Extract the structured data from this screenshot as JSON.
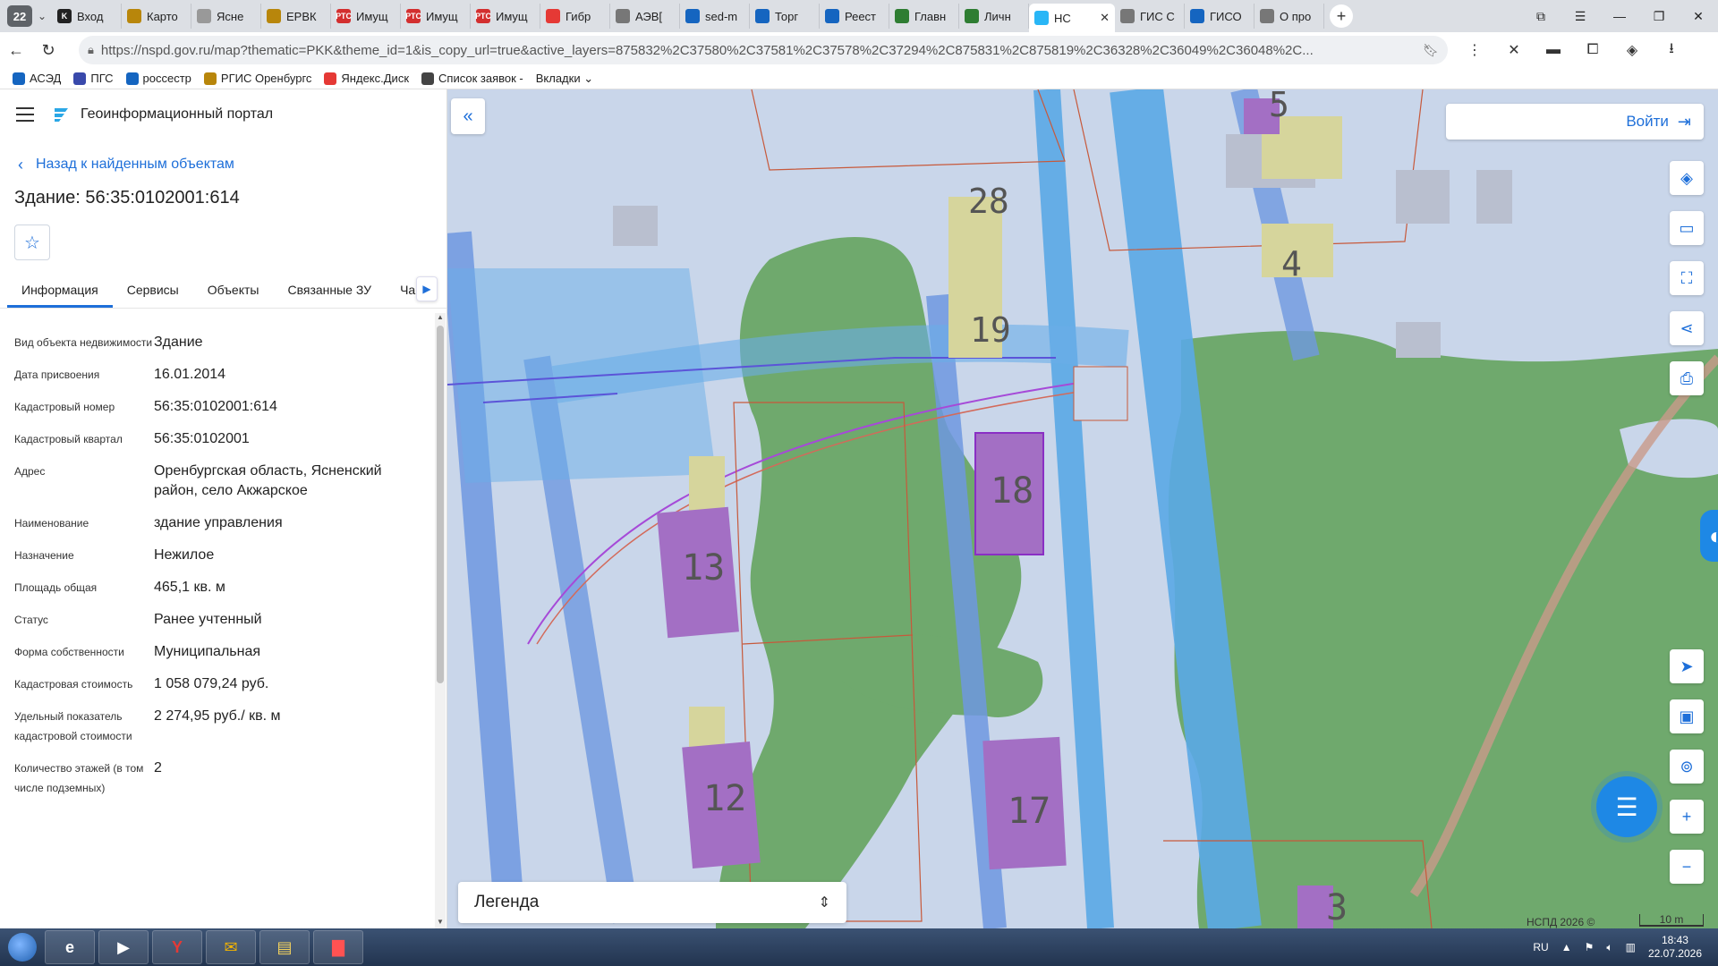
{
  "browser": {
    "tab_count": "22",
    "tabs": [
      {
        "label": "Вход",
        "color": "#222222",
        "glyph": "K"
      },
      {
        "label": "Карто",
        "color": "#b8860b",
        "glyph": ""
      },
      {
        "label": "Ясне",
        "color": "#999999",
        "glyph": ""
      },
      {
        "label": "ЕРВК",
        "color": "#b8860b",
        "glyph": ""
      },
      {
        "label": "Имущ",
        "color": "#d32f2f",
        "glyph": "РТС"
      },
      {
        "label": "Имущ",
        "color": "#d32f2f",
        "glyph": "РТС"
      },
      {
        "label": "Имущ",
        "color": "#d32f2f",
        "glyph": "РТС"
      },
      {
        "label": "Гибр",
        "color": "#e53935",
        "glyph": ""
      },
      {
        "label": "АЭВ[",
        "color": "#777777",
        "glyph": ""
      },
      {
        "label": "sed-m",
        "color": "#1565c0",
        "glyph": ""
      },
      {
        "label": "Торг",
        "color": "#1565c0",
        "glyph": ""
      },
      {
        "label": "Реест",
        "color": "#1565c0",
        "glyph": ""
      },
      {
        "label": "Главн",
        "color": "#2e7d32",
        "glyph": ""
      },
      {
        "label": "Личн",
        "color": "#2e7d32",
        "glyph": ""
      },
      {
        "label": "НС",
        "color": "#29b6f6",
        "glyph": "",
        "active": true
      },
      {
        "label": "ГИС С",
        "color": "#777777",
        "glyph": ""
      },
      {
        "label": "ГИСО",
        "color": "#1565c0",
        "glyph": ""
      },
      {
        "label": "О про",
        "color": "#777777",
        "glyph": ""
      }
    ],
    "tab_close": "✕",
    "new_tab": "+",
    "url": "https://nspd.gov.ru/map?thematic=PKK&theme_id=1&is_copy_url=true&active_layers=875832%2C37580%2C37581%2C37578%2C37294%2C875831%2C875819%2C36328%2C36049%2C36048%2C...",
    "bookmarks": [
      {
        "label": "АСЭД",
        "color": "#1565c0"
      },
      {
        "label": "ПГС",
        "color": "#3949ab"
      },
      {
        "label": "россестр",
        "color": "#1565c0"
      },
      {
        "label": "РГИС Оренбургс",
        "color": "#b8860b"
      },
      {
        "label": "Яндекс.Диск",
        "color": "#e53935"
      },
      {
        "label": "Список заявок -",
        "color": "#444444"
      },
      {
        "label": "Вкладки ⌄",
        "color": ""
      }
    ]
  },
  "panel": {
    "portal_title": "Геоинформационный портал",
    "back_link": "Назад к найденным объектам",
    "object_title": "Здание: 56:35:0102001:614",
    "tabs": [
      "Информация",
      "Сервисы",
      "Объекты",
      "Связанные ЗУ",
      "Ча"
    ],
    "fields": [
      {
        "label": "Вид объекта недвижимости",
        "value": "Здание"
      },
      {
        "label": "Дата присвоения",
        "value": "16.01.2014"
      },
      {
        "label": "Кадастровый номер",
        "value": "56:35:0102001:614"
      },
      {
        "label": "Кадастровый квартал",
        "value": "56:35:0102001"
      },
      {
        "label": "Адрес",
        "value": "Оренбургская область, Ясненский район, село Акжарское"
      },
      {
        "label": "Наименование",
        "value": "здание управления"
      },
      {
        "label": "Назначение",
        "value": "Нежилое"
      },
      {
        "label": "Площадь общая",
        "value": "465,1 кв. м"
      },
      {
        "label": "Статус",
        "value": "Ранее учтенный"
      },
      {
        "label": "Форма собственности",
        "value": "Муниципальная"
      },
      {
        "label": "Кадастровая стоимость",
        "value": "1 058 079,24 руб."
      },
      {
        "label": "Удельный показатель кадастровой стоимости",
        "value": "2 274,95 руб./ кв. м"
      },
      {
        "label": "Количество этажей (в том числе подземных)",
        "value": "2"
      }
    ]
  },
  "map": {
    "login": "Войти",
    "legend": "Легенда",
    "copyright": "НСПД 2026 ©",
    "scale": "10 m",
    "house_numbers": [
      "28",
      "19",
      "5",
      "4",
      "18",
      "13",
      "12",
      "17",
      "3"
    ],
    "colors": {
      "water_blue": "#5aa9e6",
      "green": "#6aa66a",
      "building": "#a36fc4",
      "parcel_line": "#c7593b",
      "accent": "#1e6fd9"
    }
  },
  "taskbar": {
    "lang": "RU",
    "time": "18:43",
    "date": "22.07.2026"
  }
}
